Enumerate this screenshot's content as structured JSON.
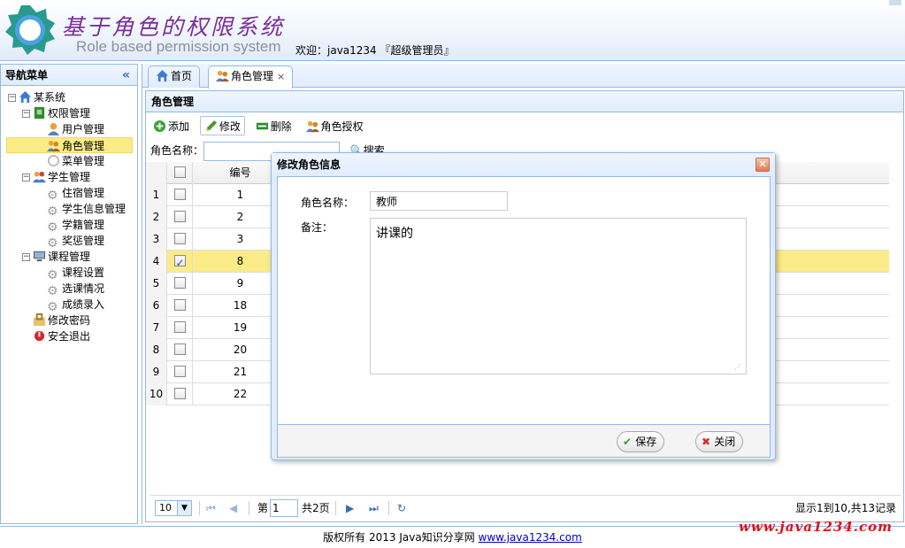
{
  "header": {
    "title_cn": "基于角色的权限系统",
    "title_en": "Role based permission system",
    "welcome": "欢迎：java1234 『超级管理员』"
  },
  "nav": {
    "title": "导航菜单",
    "collapse": "«",
    "items": [
      {
        "label": "某系统",
        "icon": "home-icon"
      },
      {
        "label": "权限管理",
        "icon": "green-book-icon"
      },
      {
        "label": "用户管理",
        "icon": "user-icon"
      },
      {
        "label": "角色管理",
        "icon": "users-icon"
      },
      {
        "label": "菜单管理",
        "icon": "menu-icon"
      },
      {
        "label": "学生管理",
        "icon": "people-icon"
      },
      {
        "label": "住宿管理",
        "icon": "gear-icon"
      },
      {
        "label": "学生信息管理",
        "icon": "gear-icon"
      },
      {
        "label": "学籍管理",
        "icon": "gear-icon"
      },
      {
        "label": "奖惩管理",
        "icon": "gear-icon"
      },
      {
        "label": "课程管理",
        "icon": "monitor-icon"
      },
      {
        "label": "课程设置",
        "icon": "gear-icon"
      },
      {
        "label": "选课情况",
        "icon": "gear-icon"
      },
      {
        "label": "成绩录入",
        "icon": "gear-icon"
      },
      {
        "label": "修改密码",
        "icon": "key-icon"
      },
      {
        "label": "安全退出",
        "icon": "exit-icon"
      }
    ]
  },
  "tabs": [
    {
      "label": "首页",
      "icon": "home-icon"
    },
    {
      "label": "角色管理",
      "icon": "users-icon",
      "close": "×"
    }
  ],
  "panel": {
    "title": "角色管理",
    "toolbar": {
      "add": "添加",
      "edit": "修改",
      "delete": "删除",
      "authorize": "角色授权"
    },
    "search_label": "角色名称：",
    "search_button": "搜索"
  },
  "grid": {
    "columns": [
      "编号"
    ],
    "rows": [
      {
        "num": "1",
        "id": "1",
        "checked": false
      },
      {
        "num": "2",
        "id": "2",
        "checked": false
      },
      {
        "num": "3",
        "id": "3",
        "checked": false
      },
      {
        "num": "4",
        "id": "8",
        "checked": true
      },
      {
        "num": "5",
        "id": "9",
        "checked": false
      },
      {
        "num": "6",
        "id": "18",
        "checked": false
      },
      {
        "num": "7",
        "id": "19",
        "checked": false
      },
      {
        "num": "8",
        "id": "20",
        "checked": false
      },
      {
        "num": "9",
        "id": "21",
        "checked": false
      },
      {
        "num": "10",
        "id": "22",
        "checked": false
      }
    ]
  },
  "pager": {
    "page_size": "10",
    "page_prefix": "第",
    "page": "1",
    "total_pages": "共2页",
    "info": "显示1到10,共13记录"
  },
  "dialog": {
    "title": "修改角色信息",
    "name_label": "角色名称：",
    "name_value": "教师",
    "remark_label": "备注：",
    "remark_value": "讲课的",
    "save": "保存",
    "close": "关闭"
  },
  "footer": {
    "text": "版权所有 2013 Java知识分享网",
    "link": "www.java1234.com"
  },
  "watermark": "www.java1234.com"
}
